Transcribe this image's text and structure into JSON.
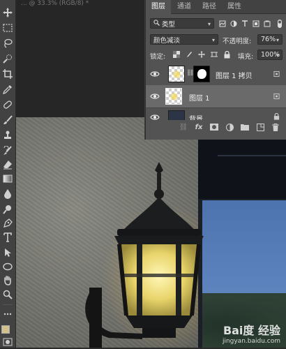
{
  "document": {
    "title_fragment": "... @ 33.3% (RGB/8) *"
  },
  "panel": {
    "tabs": [
      {
        "label": "图层",
        "active": true
      },
      {
        "label": "通道",
        "active": false
      },
      {
        "label": "路径",
        "active": false
      },
      {
        "label": "属性",
        "active": false
      }
    ],
    "filter": {
      "value": "类型"
    },
    "blend_mode": {
      "value": "颜色减淡"
    },
    "opacity": {
      "label": "不透明度:",
      "value": "76%"
    },
    "lock": {
      "label": "锁定:"
    },
    "fill": {
      "label": "填充:",
      "value": "100%"
    },
    "layers": [
      {
        "name": "图层 1 拷贝",
        "visible": true,
        "selected": false,
        "has_mask": true
      },
      {
        "name": "图层 1",
        "visible": true,
        "selected": true,
        "has_mask": false
      },
      {
        "name": "背景",
        "visible": true,
        "selected": false,
        "locked": true
      }
    ],
    "footer_icons": [
      "link-icon",
      "fx-icon",
      "add-mask-icon",
      "adjustment-icon",
      "folder-icon",
      "new-layer-icon",
      "trash-icon"
    ]
  },
  "toolbar": {
    "tools": [
      "move-tool-icon",
      "marquee-tool-icon",
      "lasso-tool-icon",
      "quick-select-tool-icon",
      "crop-tool-icon",
      "eyedropper-tool-icon",
      "healing-brush-tool-icon",
      "brush-tool-icon",
      "clone-stamp-tool-icon",
      "history-brush-tool-icon",
      "eraser-tool-icon",
      "gradient-tool-icon",
      "blur-tool-icon",
      "dodge-tool-icon",
      "pen-tool-icon",
      "type-tool-icon",
      "path-select-tool-icon",
      "shape-tool-icon",
      "hand-tool-icon",
      "zoom-tool-icon"
    ],
    "foreground_color": "#d4c08f",
    "background_color": "#e9e0c9"
  },
  "watermark": {
    "brand": "Bai度 经验",
    "url": "jingyan.baidu.com"
  }
}
